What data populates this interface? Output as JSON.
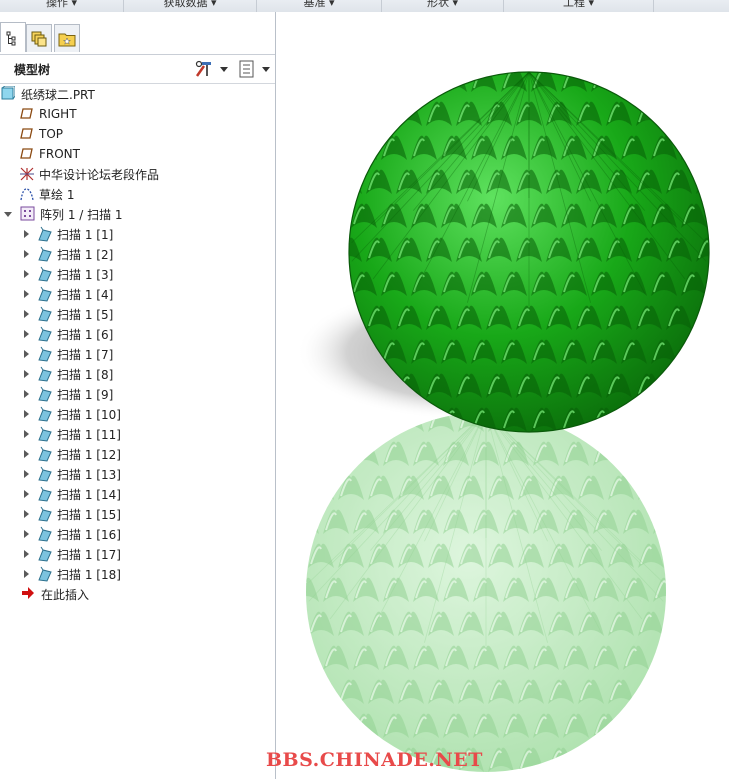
{
  "ribbon": {
    "groups": [
      "操作 ▾",
      "获取数据 ▾",
      "基准 ▾",
      "形状 ▾",
      "工程 ▾"
    ]
  },
  "navigator": {
    "tabs": [
      "model-tree-tab",
      "layers-tab",
      "favorites-tab"
    ],
    "title": "模型树",
    "settings_icon": "tree-settings-icon",
    "show_icon": "tree-show-icon"
  },
  "tree": {
    "root": "纸绣球二.PRT",
    "datums": [
      "RIGHT",
      "TOP",
      "FRONT"
    ],
    "csys": "中华设计论坛老段作品",
    "sketch": "草绘 1",
    "pattern": "阵列 1 / 扫描 1",
    "sweeps": [
      "扫描 1 [1]",
      "扫描 1 [2]",
      "扫描 1 [3]",
      "扫描 1 [4]",
      "扫描 1 [5]",
      "扫描 1 [6]",
      "扫描 1 [7]",
      "扫描 1 [8]",
      "扫描 1 [9]",
      "扫描 1 [10]",
      "扫描 1 [11]",
      "扫描 1 [12]",
      "扫描 1 [13]",
      "扫描 1 [14]",
      "扫描 1 [15]",
      "扫描 1 [16]",
      "扫描 1 [17]",
      "扫描 1 [18]"
    ],
    "insert_here": "在此插入"
  },
  "viewport": {
    "model_color": "#1cad1c",
    "reflection_color": "#a6e3a6"
  },
  "watermark": "BBS.CHINADE.NET"
}
